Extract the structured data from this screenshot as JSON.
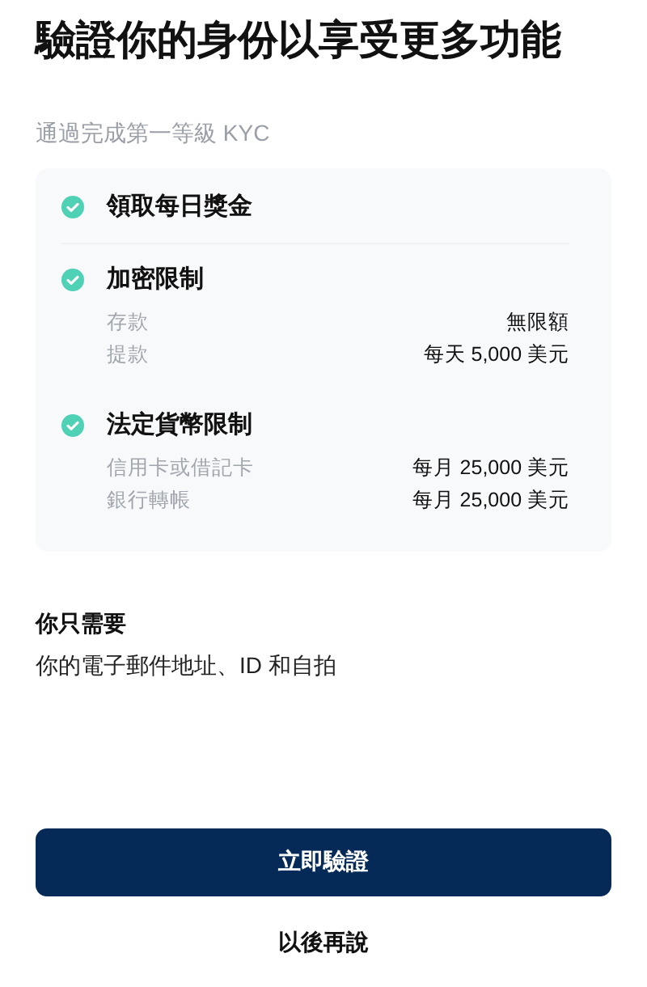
{
  "title": "驗證你的身份以享受更多功能",
  "subtitle": "通過完成第一等級 KYC",
  "features": [
    {
      "title": "領取每日獎金",
      "checked": true
    },
    {
      "title": "加密限制",
      "checked": true,
      "limits": [
        {
          "label": "存款",
          "value": "無限額"
        },
        {
          "label": "提款",
          "value": "每天 5,000 美元"
        }
      ]
    },
    {
      "title": "法定貨幣限制",
      "checked": true,
      "limits": [
        {
          "label": "信用卡或借記卡",
          "value": "每月 25,000 美元"
        },
        {
          "label": "銀行轉帳",
          "value": "每月 25,000 美元"
        }
      ]
    }
  ],
  "requirements": {
    "heading": "你只需要",
    "text": "你的電子郵件地址、ID 和自拍"
  },
  "primary_button": "立即驗證",
  "secondary_button": "以後再說"
}
